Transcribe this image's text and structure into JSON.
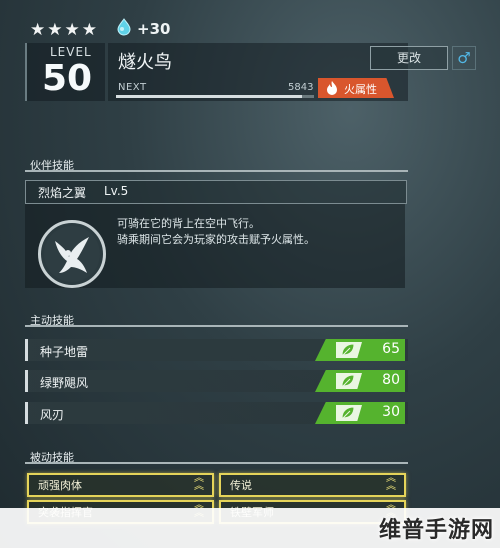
{
  "header": {
    "stars": "★★★★",
    "gem_count": "+30",
    "level_label": "LEVEL",
    "level_value": "50",
    "name": "燧火鸟",
    "rename_label": "更改",
    "gender_symbol": "♂",
    "next_label": "NEXT",
    "next_value": "5843",
    "exp_progress": 0.94,
    "element_label": "火属性",
    "element_icon": "fire-icon",
    "element_color": "#d9562d"
  },
  "partner_skill": {
    "section_label": "伙伴技能",
    "name": "烈焰之翼",
    "level": "Lv.5",
    "description_line1": "可骑在它的背上在空中飞行。",
    "description_line2": "骑乘期间它会为玩家的攻击赋予火属性。",
    "emblem_icon": "bird-emblem-icon"
  },
  "active_skills": {
    "section_label": "主动技能",
    "items": [
      {
        "name": "种子地雷",
        "power": "65",
        "icon": "leaf-icon"
      },
      {
        "name": "绿野飓风",
        "power": "80",
        "icon": "leaf-icon"
      },
      {
        "name": "风刃",
        "power": "30",
        "icon": "leaf-icon"
      }
    ],
    "accent_color": "#55b32e"
  },
  "passive_skills": {
    "section_label": "被动技能",
    "items": [
      {
        "name": "顽强肉体"
      },
      {
        "name": "传说"
      },
      {
        "name": "突袭指挥官"
      },
      {
        "name": "铁壁军师"
      }
    ],
    "border_color": "#e5d45a"
  },
  "watermark": "维普手游网"
}
